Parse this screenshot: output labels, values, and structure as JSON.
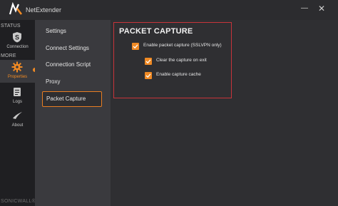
{
  "window": {
    "title": "NetExtender",
    "minimize_glyph": "—",
    "close_glyph": "✕"
  },
  "sidebar": {
    "status_section": "STATUS",
    "more_section": "MORE",
    "items": [
      {
        "label": "Connection",
        "icon": "shield-s-icon"
      },
      {
        "label": "Properties",
        "icon": "gear-icon",
        "active": true
      },
      {
        "label": "Logs",
        "icon": "logs-icon"
      },
      {
        "label": "About",
        "icon": "swoosh-icon"
      }
    ],
    "brand": "SONICWALL®"
  },
  "menu": {
    "items": [
      {
        "label": "Settings"
      },
      {
        "label": "Connect Settings"
      },
      {
        "label": "Connection Script"
      },
      {
        "label": "Proxy"
      },
      {
        "label": "Packet Capture",
        "selected": true
      }
    ]
  },
  "packet_capture": {
    "title": "PACKET CAPTURE",
    "options": [
      {
        "label": "Enable packet capture (SSLVPN only)",
        "checked": true
      },
      {
        "label": "Clear the capture on exit",
        "checked": true
      },
      {
        "label": "Enable capture cache",
        "checked": true
      }
    ]
  },
  "colors": {
    "accent": "#f08a24",
    "highlight_border": "#c8343a",
    "sidebar_bg": "#1f1f22",
    "content_bg": "#2f2f32"
  }
}
